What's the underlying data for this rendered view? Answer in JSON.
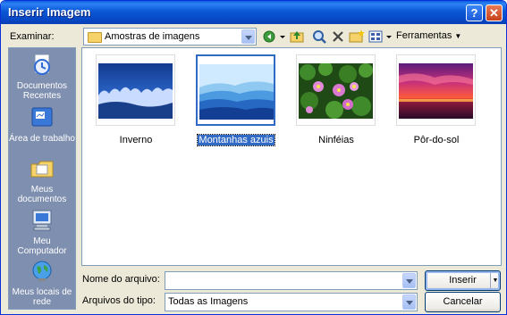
{
  "window": {
    "title": "Inserir Imagem"
  },
  "look_in": {
    "label": "Examinar:",
    "value": "Amostras de imagens"
  },
  "toolbar": {
    "tools_label": "Ferramentas"
  },
  "places": [
    {
      "label": "Documentos Recentes"
    },
    {
      "label": "Área de trabalho"
    },
    {
      "label": "Meus documentos"
    },
    {
      "label": "Meu Computador"
    },
    {
      "label": "Meus locais de rede"
    }
  ],
  "files": [
    {
      "name": "Inverno"
    },
    {
      "name": "Montanhas azuis"
    },
    {
      "name": "Ninféias"
    },
    {
      "name": "Pôr-do-sol"
    }
  ],
  "filename": {
    "label": "Nome do arquivo:",
    "value": ""
  },
  "filetype": {
    "label": "Arquivos do tipo:",
    "value": "Todas as Imagens"
  },
  "buttons": {
    "insert": "Inserir",
    "cancel": "Cancelar"
  }
}
